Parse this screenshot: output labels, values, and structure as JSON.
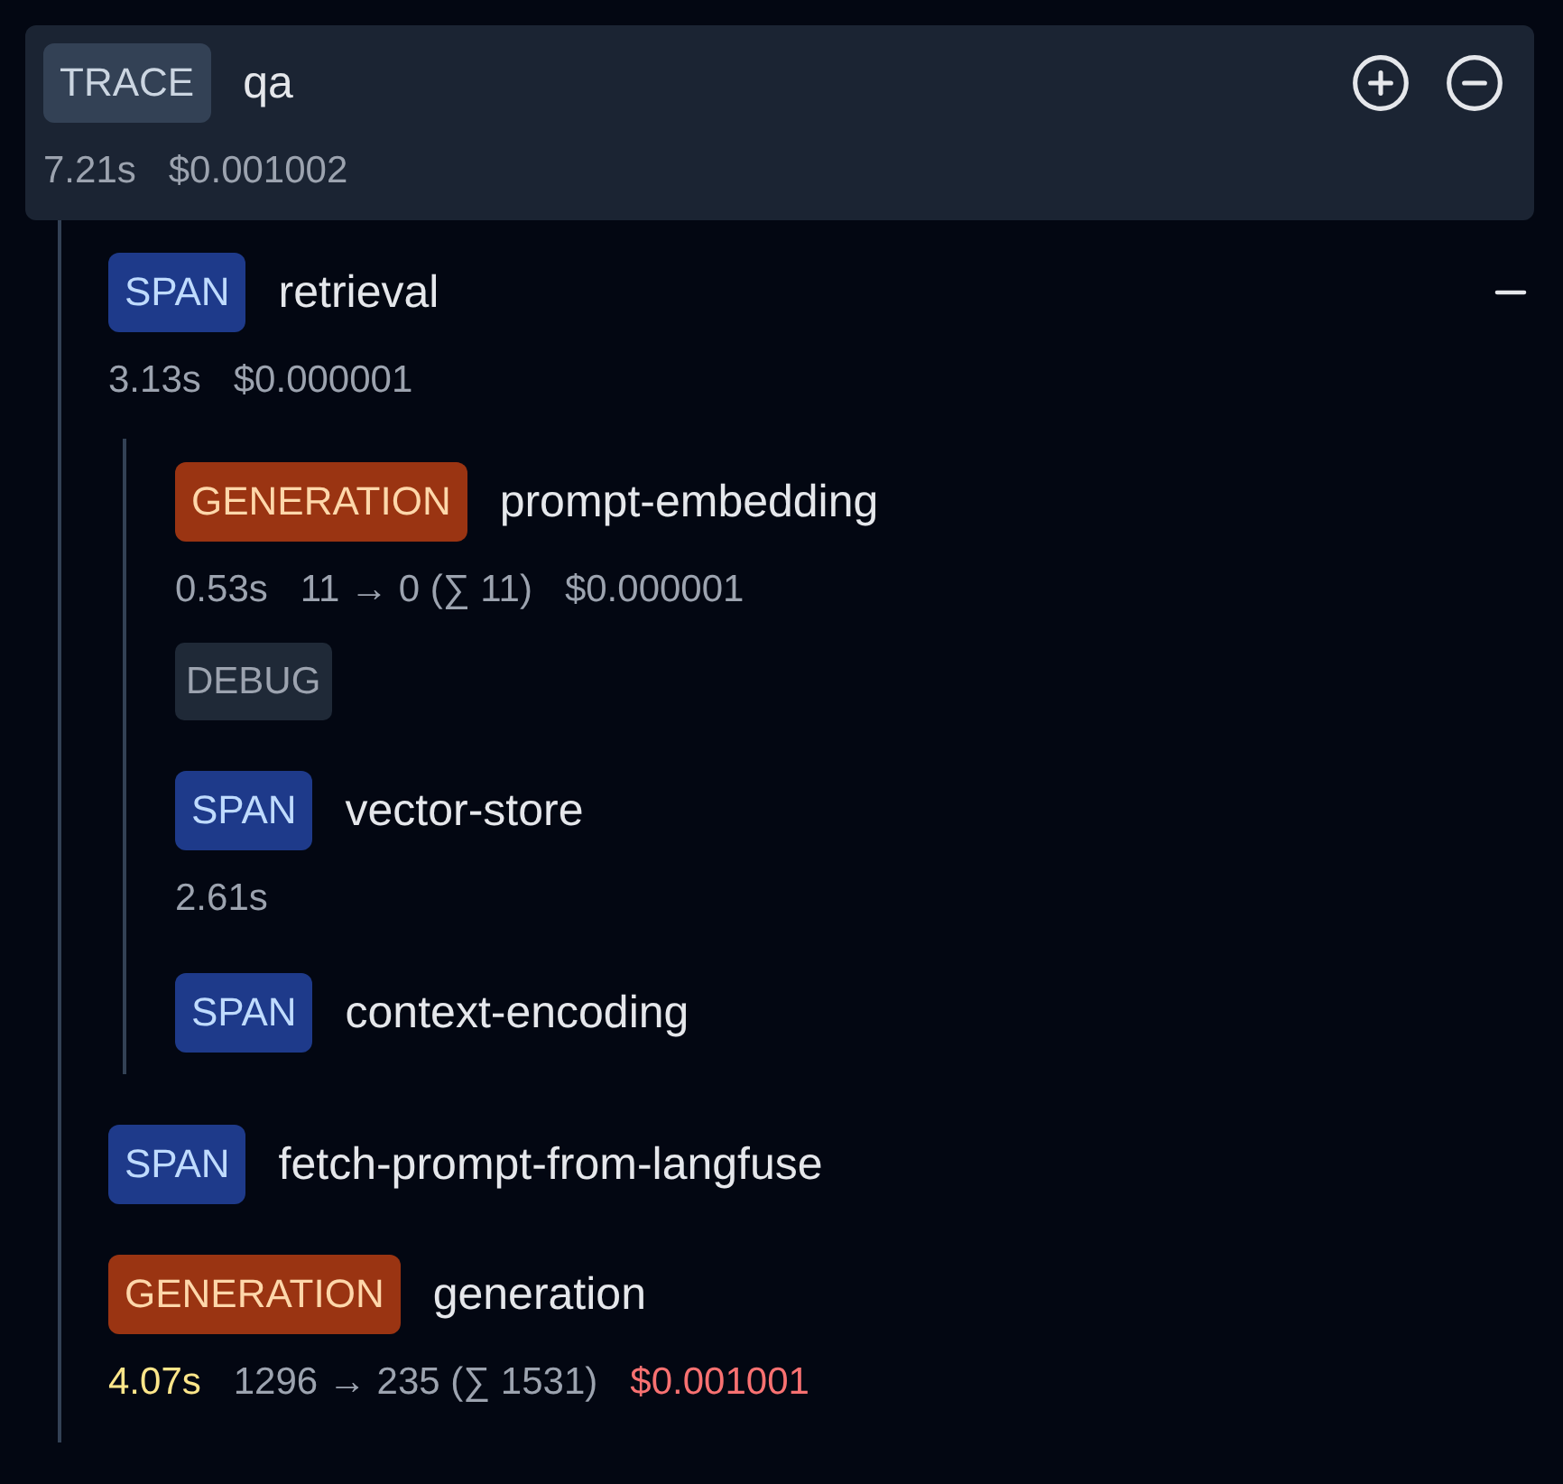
{
  "trace": {
    "kind": "trace",
    "type": "TRACE",
    "name": "qa",
    "metrics": [
      {
        "text": "7.21s"
      },
      {
        "text": "$0.001002"
      }
    ],
    "children": [
      {
        "kind": "span",
        "type": "SPAN",
        "name": "retrieval",
        "expanded": true,
        "metrics": [
          {
            "text": "3.13s"
          },
          {
            "text": "$0.000001"
          }
        ],
        "children": [
          {
            "kind": "generation",
            "type": "GENERATION",
            "name": "prompt-embedding",
            "metrics": [
              {
                "text": "0.53s"
              },
              {
                "text": "11 → 0 (∑ 11)"
              },
              {
                "text": "$0.000001"
              }
            ],
            "level_badge": "DEBUG"
          },
          {
            "kind": "span",
            "type": "SPAN",
            "name": "vector-store",
            "metrics": [
              {
                "text": "2.61s"
              }
            ]
          },
          {
            "kind": "span",
            "type": "SPAN",
            "name": "context-encoding"
          }
        ]
      },
      {
        "kind": "span",
        "type": "SPAN",
        "name": "fetch-prompt-from-langfuse"
      },
      {
        "kind": "generation",
        "type": "GENERATION",
        "name": "generation",
        "metrics": [
          {
            "text": "4.07s",
            "color": "#fde68a"
          },
          {
            "text": "1296 → 235 (∑ 1531)"
          },
          {
            "text": "$0.001001",
            "color": "#f87171"
          }
        ]
      }
    ]
  }
}
